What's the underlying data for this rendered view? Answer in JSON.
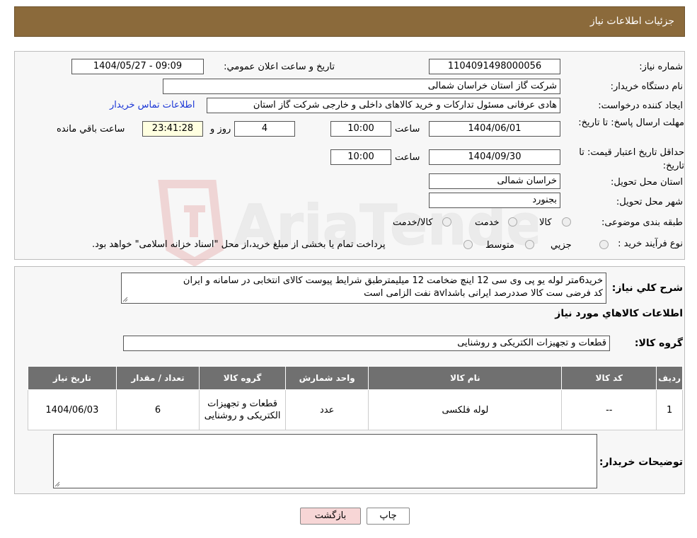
{
  "header": {
    "title": "جزئیات اطلاعات نیاز"
  },
  "watermark": {
    "text": "AriaTender.neT"
  },
  "details": {
    "need_number_label": "شماره نیاز:",
    "need_number": "1104091498000056",
    "announce_label": "تاریخ و ساعت اعلان عمومي:",
    "announce_value": "1404/05/27 - 09:09",
    "buyer_org_label": "نام دستگاه خريدار:",
    "buyer_org": "شرکت گاز استان خراسان شمالی",
    "creator_label": "ایجاد کننده درخواست:",
    "creator": "هادی عرفانی مسئول تدارکات و خرید کالاهای داخلی و خارجی شرکت گاز استان",
    "contact_link": "اطلاعات تماس خریدار",
    "deadline_label": "مهلت ارسال پاسخ: تا تاریخ:",
    "deadline_date": "1404/06/01",
    "time_label": "ساعت",
    "deadline_time": "10:00",
    "days_count": "4",
    "days_and_label": "روز و",
    "remaining_time": "23:41:28",
    "remaining_label": "ساعت باقي مانده",
    "validity_label": "حداقل تاریخ اعتبار قیمت: تا تاریخ:",
    "validity_date": "1404/09/30",
    "validity_time": "10:00",
    "province_label": "استان محل تحویل:",
    "province": "خراسان شمالی",
    "city_label": "شهر محل تحویل:",
    "city": "بجنورد",
    "category_label": "طبقه بندی موضوعی:",
    "category_options": [
      "کالا",
      "خدمت",
      "کالا/خدمت"
    ],
    "process_label": "نوع فرآيند خريد :",
    "process_options": [
      "جزیي",
      "متوسط"
    ],
    "process_note": "پرداخت تمام یا بخشی از مبلغ خرید،از محل \"اسناد خزانه اسلامی\" خواهد بود."
  },
  "description": {
    "label": "شرح کلي نياز:",
    "line1": "خرید6متر لوله یو پی وی سی 12 اینچ ضخامت 12 میلیمترطبق شرایط پیوست کالای انتخابی در سامانه و ایران",
    "line2": "کد فرضی ست کالا صددرصد ایرانی باشدavl نفت الزامی است",
    "items_title": "اطلاعات کالاهاي مورد نياز",
    "group_label": "گروه کالا:",
    "group_value": "قطعات و تجهیزات الکتریکی و روشنایی"
  },
  "table": {
    "headers": [
      "رديف",
      "کد کالا",
      "نام کالا",
      "واحد شمارش",
      "گروه کالا",
      "تعداد / مقدار",
      "تاريخ نياز"
    ],
    "rows": [
      [
        "1",
        "--",
        "لوله فلکسی",
        "عدد",
        "قطعات و تجهیزات الکتریکی و روشنایی",
        "6",
        "1404/06/03"
      ]
    ]
  },
  "buyer_notes": {
    "label": "توضیحات خریدار:",
    "value": ""
  },
  "buttons": {
    "print": "چاپ",
    "back": "بازگشت"
  },
  "colors": {
    "header": "#8b6a3b",
    "table_header": "#707070",
    "link": "#1a35d6",
    "back_button": "#f7d6d6"
  }
}
